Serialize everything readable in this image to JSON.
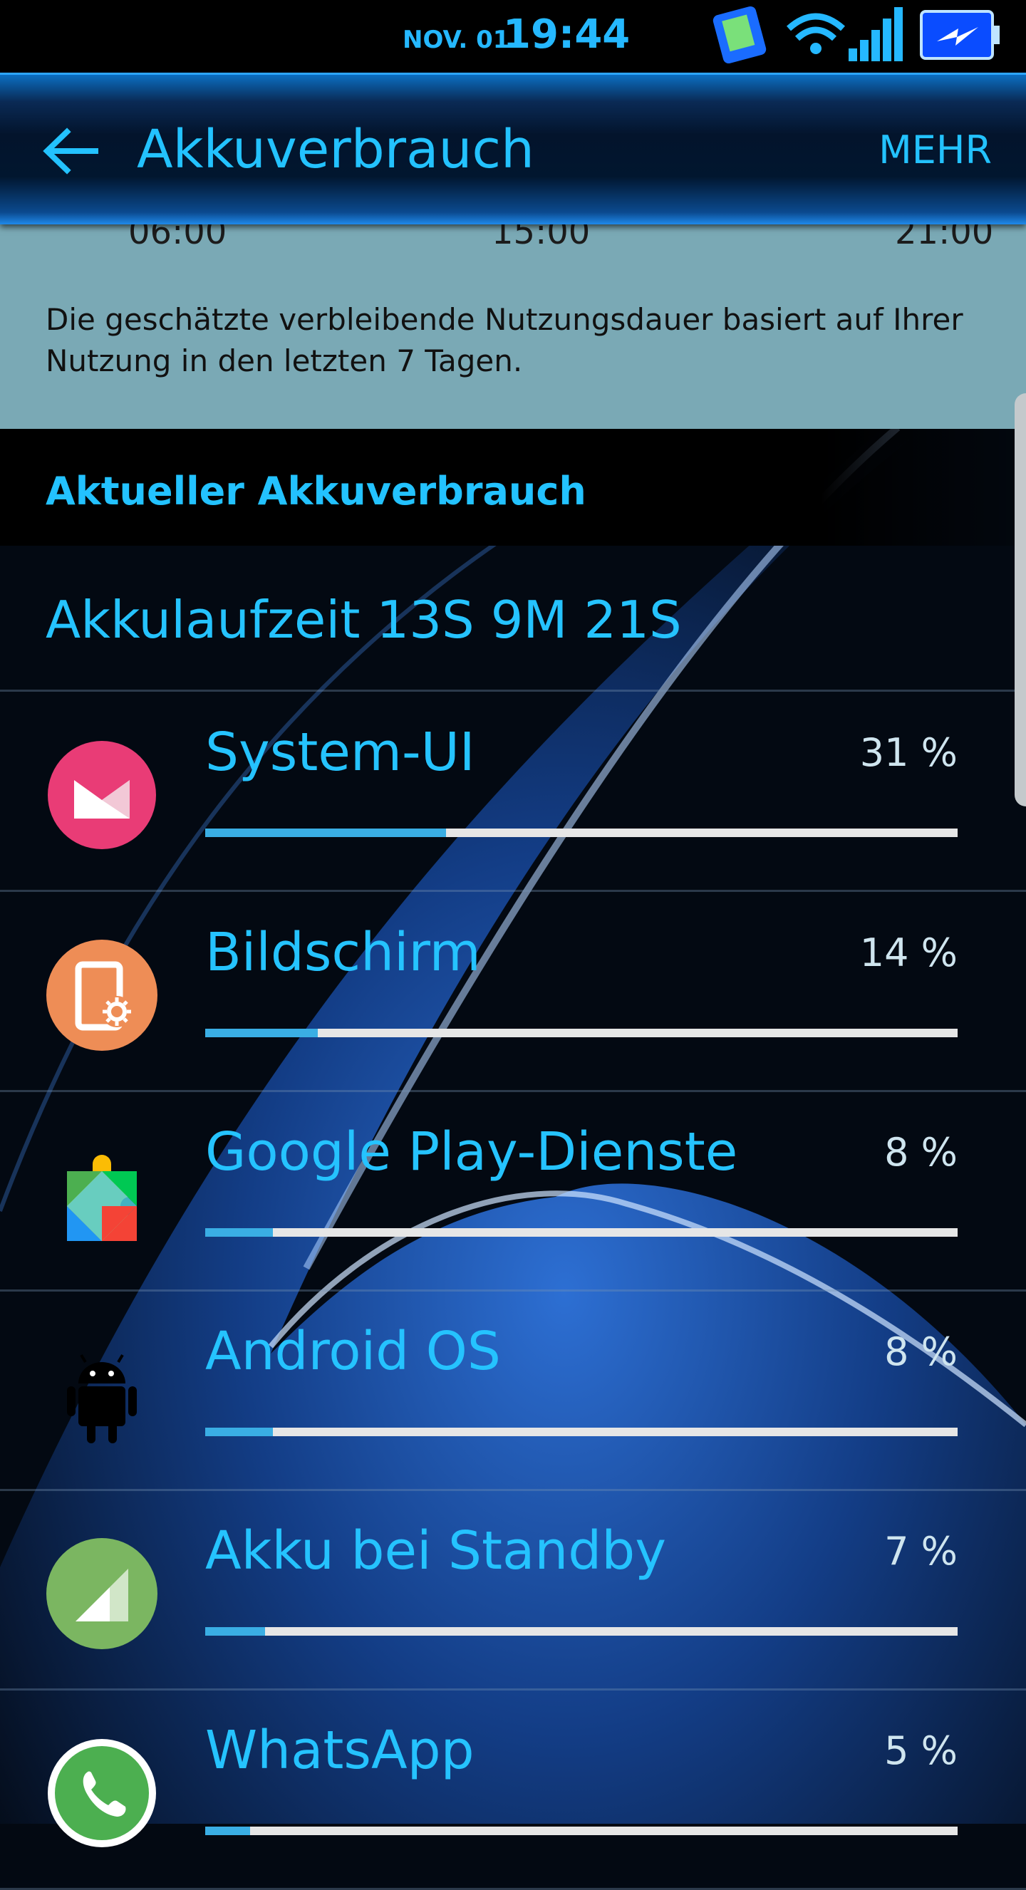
{
  "status_bar": {
    "date": "NOV. 01",
    "time": "19:44"
  },
  "app_bar": {
    "title": "Akkuverbrauch",
    "more_label": "MEHR"
  },
  "usage_chart": {
    "tick_labels": [
      "06:00",
      "15:00",
      "21:00"
    ]
  },
  "info": {
    "text": "Die geschätzte verbleibende Nutzungsdauer basiert auf Ihrer Nutzung in den letzten 7 Tagen."
  },
  "section": {
    "title": "Aktueller Akkuverbrauch"
  },
  "runtime": {
    "label": "Akkulaufzeit 13S 9M 21S"
  },
  "apps": [
    {
      "name": "System-UI",
      "percent_label": "31 %",
      "fill": 0.32,
      "icon": "marshmallow-icon",
      "icon_color": "#e93c76"
    },
    {
      "name": "Bildschirm",
      "percent_label": "14 %",
      "fill": 0.15,
      "icon": "screen-brightness-icon",
      "icon_color": "#ee8d56"
    },
    {
      "name": "Google Play-Dienste",
      "percent_label": "8 %",
      "fill": 0.09,
      "icon": "google-play-services-icon",
      "icon_color": "#4caf50"
    },
    {
      "name": "Android OS",
      "percent_label": "8 %",
      "fill": 0.09,
      "icon": "android-icon",
      "icon_color": "#000000"
    },
    {
      "name": "Akku bei Standby",
      "percent_label": "7 %",
      "fill": 0.08,
      "icon": "cell-standby-icon",
      "icon_color": "#7bb661"
    },
    {
      "name": "WhatsApp",
      "percent_label": "5 %",
      "fill": 0.06,
      "icon": "whatsapp-icon",
      "icon_color": "#4caf50"
    }
  ],
  "colors": {
    "accent": "#25c3ff",
    "bar_fill": "#3aaee4",
    "bar_track": "#e6e6e6",
    "info_panel": "#7aa9b5"
  }
}
